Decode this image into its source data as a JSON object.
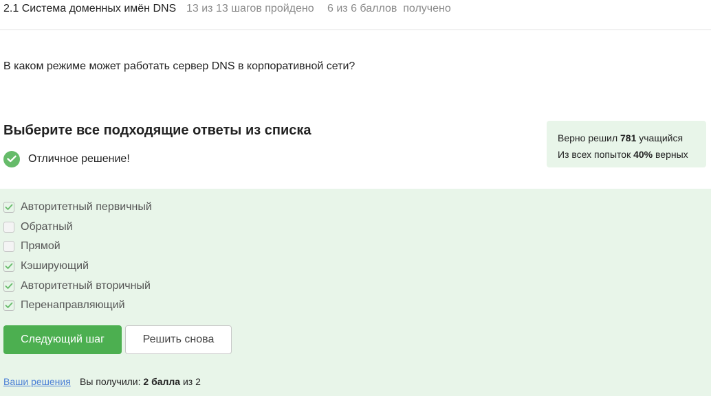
{
  "header": {
    "lesson_title": "2.1 Система доменных имён DNS",
    "steps_progress": "13 из 13 шагов пройдено",
    "points_progress": "6 из 6 баллов  получено"
  },
  "question": {
    "text": "В каком режиме может работать сервер DNS в корпоративной сети?"
  },
  "task": {
    "heading": "Выберите все подходящие ответы из списка",
    "feedback_text": "Отличное решение!",
    "feedback_icon": "check-circle-icon",
    "accent_color": "#66bb6a"
  },
  "stats": {
    "solved_prefix": "Верно решил",
    "solved_count": "781",
    "solved_suffix": "учащийся",
    "attempts_prefix": "Из всех попыток",
    "attempts_percent": "40%",
    "attempts_suffix": "верных"
  },
  "options": [
    {
      "label": "Авторитетный первичный",
      "checked": true
    },
    {
      "label": "Обратный",
      "checked": false
    },
    {
      "label": "Прямой",
      "checked": false
    },
    {
      "label": "Кэширующий",
      "checked": true
    },
    {
      "label": "Авторитетный вторичный",
      "checked": true
    },
    {
      "label": "Перенаправляющий",
      "checked": true
    }
  ],
  "buttons": {
    "next_label": "Следующий шаг",
    "retry_label": "Решить снова"
  },
  "footer": {
    "solutions_link": "Ваши решения",
    "score_prefix": "Вы получили:",
    "score_value": "2 балла",
    "score_suffix": "из 2"
  }
}
